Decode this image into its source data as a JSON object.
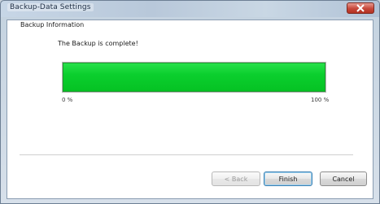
{
  "window": {
    "title": "Backup-Data Settings"
  },
  "content": {
    "group_label": "Backup Information",
    "status_text": "The Backup is complete!",
    "progress": {
      "percent": 100,
      "min_label": "0 %",
      "max_label": "100 %",
      "fill_color": "#0bcf2e"
    }
  },
  "buttons": {
    "back_label": "< Back",
    "finish_label": "Finish",
    "cancel_label": "Cancel"
  },
  "icons": {
    "close": "close-icon"
  }
}
